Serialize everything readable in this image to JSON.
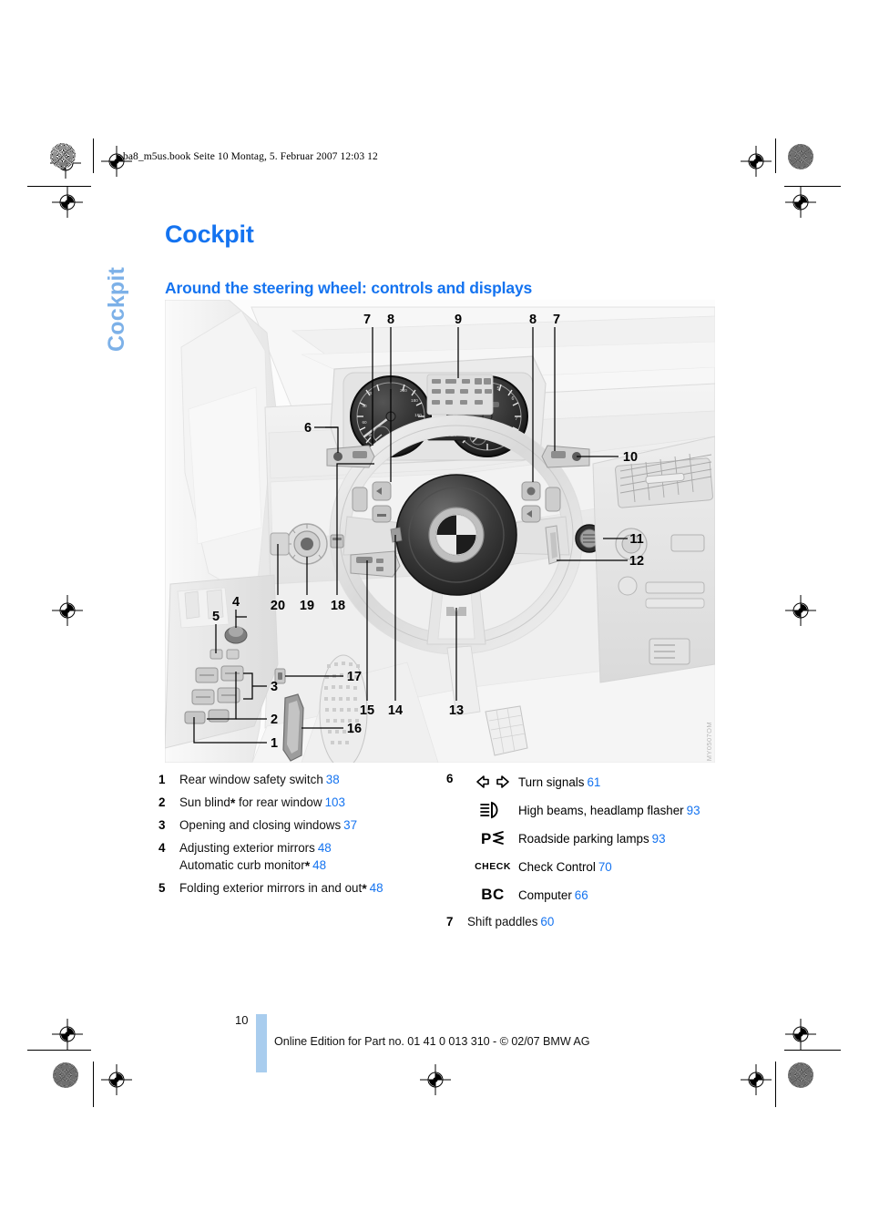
{
  "running_head": "ba8_m5us.book  Seite 10  Montag, 5. Februar 2007  12:03 12",
  "chapter_tab": "Cockpit",
  "headings": {
    "h1": "Cockpit",
    "h2": "Around the steering wheel: controls and displays"
  },
  "figure": {
    "alt": "BMW M5 cockpit: steering wheel, instrument cluster, door controls",
    "code": "MY0507OM",
    "callouts": [
      "1",
      "2",
      "3",
      "4",
      "5",
      "6",
      "7",
      "8",
      "9",
      "10",
      "11",
      "12",
      "13",
      "14",
      "15",
      "16",
      "17",
      "18",
      "19",
      "20"
    ]
  },
  "legend_left": [
    {
      "num": "1",
      "text": "Rear window safety switch",
      "star": false,
      "page": "38"
    },
    {
      "num": "2",
      "text": "Sun blind",
      "star": true,
      "text2": " for rear window",
      "page": "103"
    },
    {
      "num": "3",
      "text": "Opening and closing windows",
      "star": false,
      "page": "37"
    },
    {
      "num": "4",
      "text": "Adjusting exterior mirrors",
      "star": false,
      "page": "48",
      "sub_text": "Automatic curb monitor",
      "sub_star": true,
      "sub_page": "48"
    },
    {
      "num": "5",
      "text": "Folding exterior mirrors in and out",
      "star": true,
      "page": "48"
    }
  ],
  "legend_right": {
    "group_num": "6",
    "items": [
      {
        "icon": "turn-signals-icon",
        "label": "Turn signals",
        "page": "61"
      },
      {
        "icon": "high-beams-icon",
        "label": "High beams, headlamp flasher",
        "page": "93"
      },
      {
        "icon": "roadside-parking-lamps-icon",
        "label": "Roadside parking lamps",
        "page": "93"
      },
      {
        "icon": "check-control-icon",
        "glyph": "CHECK",
        "label": "Check Control",
        "page": "70"
      },
      {
        "icon": "computer-icon",
        "glyph": "BC",
        "label": "Computer",
        "page": "66"
      }
    ],
    "last": {
      "num": "7",
      "label": "Shift paddles",
      "page": "60"
    }
  },
  "footer": {
    "page_number": "10",
    "notice": "Online Edition for Part no. 01 41 0 013 310 - © 02/07 BMW AG"
  },
  "colors": {
    "accent_blue": "#1473f0",
    "tab_blue": "#7db1e8",
    "bar_blue": "#a9cdee",
    "text": "#111111"
  }
}
